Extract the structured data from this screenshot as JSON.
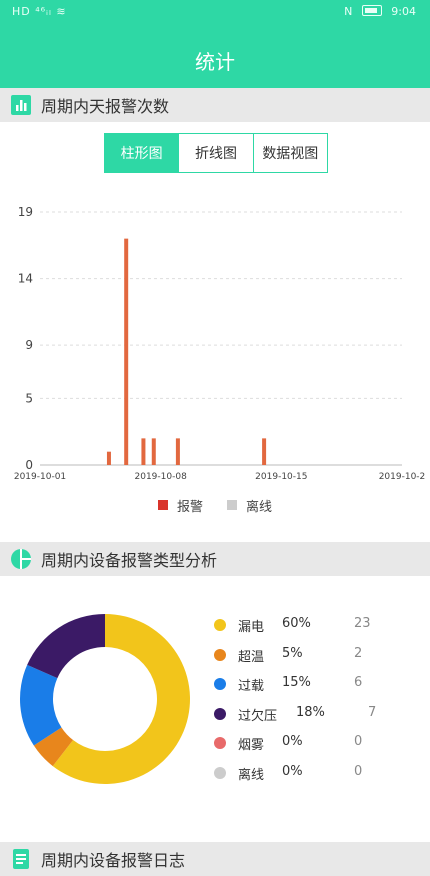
{
  "status": {
    "left": "HD ⁴⁶ᵢₗ ≋",
    "time": "9:04",
    "nfc": "N"
  },
  "header": {
    "title": "统计"
  },
  "section1": {
    "title": "周期内天报警次数"
  },
  "tabs": [
    {
      "label": "柱形图",
      "active": true
    },
    {
      "label": "折线图",
      "active": false
    },
    {
      "label": "数据视图",
      "active": false
    }
  ],
  "section2": {
    "title": "周期内设备报警类型分析"
  },
  "section3": {
    "title": "周期内设备报警日志"
  },
  "colors": {
    "accent": "#2ed8a5",
    "bar": "#e2683f",
    "offline": "#cccccc",
    "alarm_legend": "#d9342b"
  },
  "chart_data": [
    {
      "type": "bar",
      "title": "",
      "xlabel": "",
      "ylabel": "",
      "x_ticks": [
        "2019-10-01",
        "2019-10-08",
        "2019-10-15",
        "2019-10-2"
      ],
      "y_ticks": [
        "19",
        "14",
        "9",
        "5",
        "0"
      ],
      "ylim": [
        0,
        19
      ],
      "grid": true,
      "legend_position": "bottom",
      "series": [
        {
          "name": "报警",
          "color": "#e2683f",
          "points": [
            {
              "x": "2019-10-05",
              "y": 1
            },
            {
              "x": "2019-10-06",
              "y": 17
            },
            {
              "x": "2019-10-07",
              "y": 2
            },
            {
              "x": "2019-10-07.6",
              "y": 2
            },
            {
              "x": "2019-10-09",
              "y": 2
            },
            {
              "x": "2019-10-14",
              "y": 2
            }
          ]
        },
        {
          "name": "离线",
          "color": "#cccccc",
          "points": []
        }
      ],
      "legend": [
        {
          "label": "报警",
          "color": "#d9342b"
        },
        {
          "label": "离线",
          "color": "#cccccc"
        }
      ]
    },
    {
      "type": "pie",
      "title": "",
      "legend_position": "right",
      "slices": [
        {
          "label": "漏电",
          "percent": "60%",
          "value": 23,
          "color": "#f2c51b"
        },
        {
          "label": "超温",
          "percent": "5%",
          "value": 2,
          "color": "#e8861c"
        },
        {
          "label": "过载",
          "percent": "15%",
          "value": 6,
          "color": "#1a7de8"
        },
        {
          "label": "过欠压",
          "percent": "18%",
          "value": 7,
          "color": "#3b1a66"
        },
        {
          "label": "烟雾",
          "percent": "0%",
          "value": 0,
          "color": "#e86a6a"
        },
        {
          "label": "离线",
          "percent": "0%",
          "value": 0,
          "color": "#cccccc"
        }
      ]
    }
  ]
}
